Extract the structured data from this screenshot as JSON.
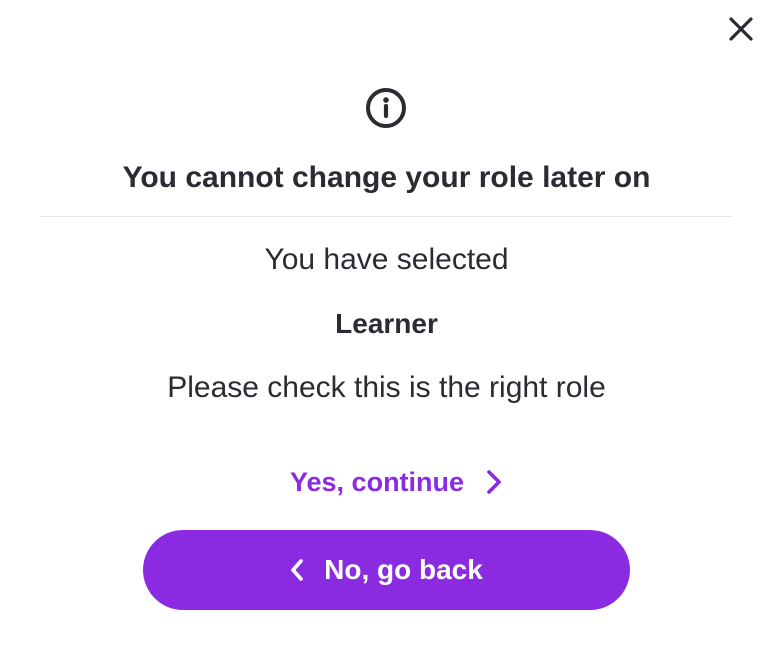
{
  "dialog": {
    "close_icon": "close-icon",
    "info_icon": "info-icon",
    "title": "You cannot change your role later on",
    "selected_label": "You have selected",
    "role_name": "Learner",
    "check_text": "Please check this is the right role",
    "continue_label": "Yes, continue",
    "continue_icon": "chevron-right-icon",
    "back_label": "No, go back",
    "back_icon": "chevron-left-icon"
  },
  "colors": {
    "accent": "#8a2be2",
    "text": "#2b2b33",
    "divider": "#e6e6ea",
    "background": "#ffffff"
  }
}
